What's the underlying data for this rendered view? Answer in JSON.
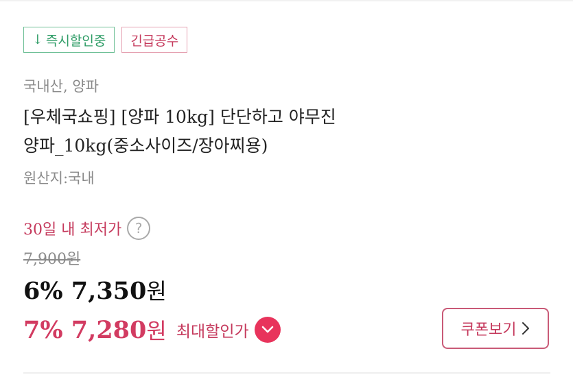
{
  "badges": {
    "instant_arrow": "↓",
    "instant_discount": "즉시할인중",
    "urgent_supply": "긴급공수"
  },
  "product": {
    "category": "국내산, 양파",
    "title_line1": "[우체국쇼핑] [양파 10kg] 단단하고 야무진",
    "title_line2": "양파_10kg(중소사이즈/장아찌용)",
    "origin": "원산지:국내"
  },
  "pricing": {
    "lowest_30d_label": "30일 내 최저가",
    "help_symbol": "?",
    "original_price": "7,900원",
    "sale_price": "6% 7,350",
    "sale_unit": "원",
    "max_discount_price": "7% 7,280",
    "max_discount_unit": "원",
    "max_discount_label": "최대할인가"
  },
  "coupon": {
    "button_label": "쿠폰보기"
  },
  "colors": {
    "accent_red": "#d23b61",
    "badge_green": "#2e9c66",
    "chevron_circle": "#e8345c",
    "muted_gray": "#8a8a8a"
  },
  "icons": {
    "help": "question-circle-icon",
    "expand": "chevron-down-icon",
    "coupon_arrow": "chevron-right-icon"
  }
}
